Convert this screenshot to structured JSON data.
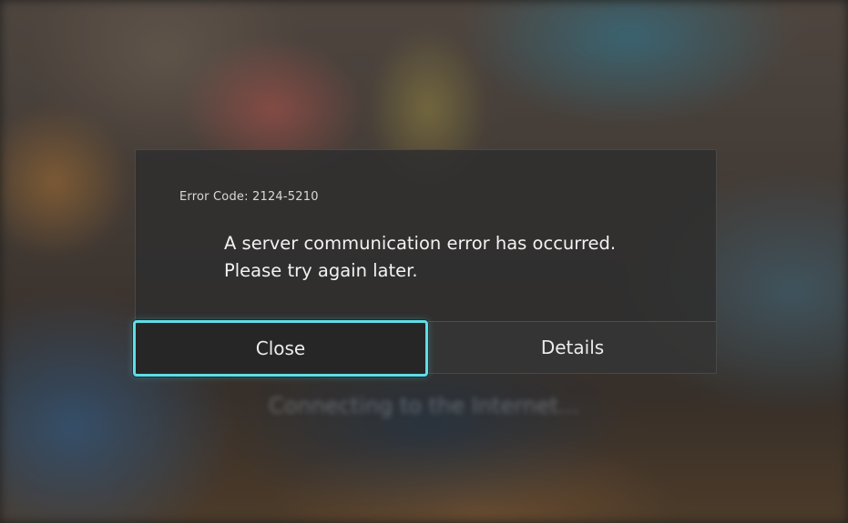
{
  "dialog": {
    "error_code": "Error Code: 2124-5210",
    "message_line1": "A server communication error has occurred.",
    "message_line2": "Please try again later.",
    "buttons": {
      "close_label": "Close",
      "details_label": "Details"
    },
    "focused_button": "Close"
  },
  "background": {
    "status_text": "Connecting to the Internet..."
  },
  "colors": {
    "focus_ring": "#5fdde6",
    "dialog_bg": "#2e2e2e",
    "text": "#f2f2f2"
  }
}
